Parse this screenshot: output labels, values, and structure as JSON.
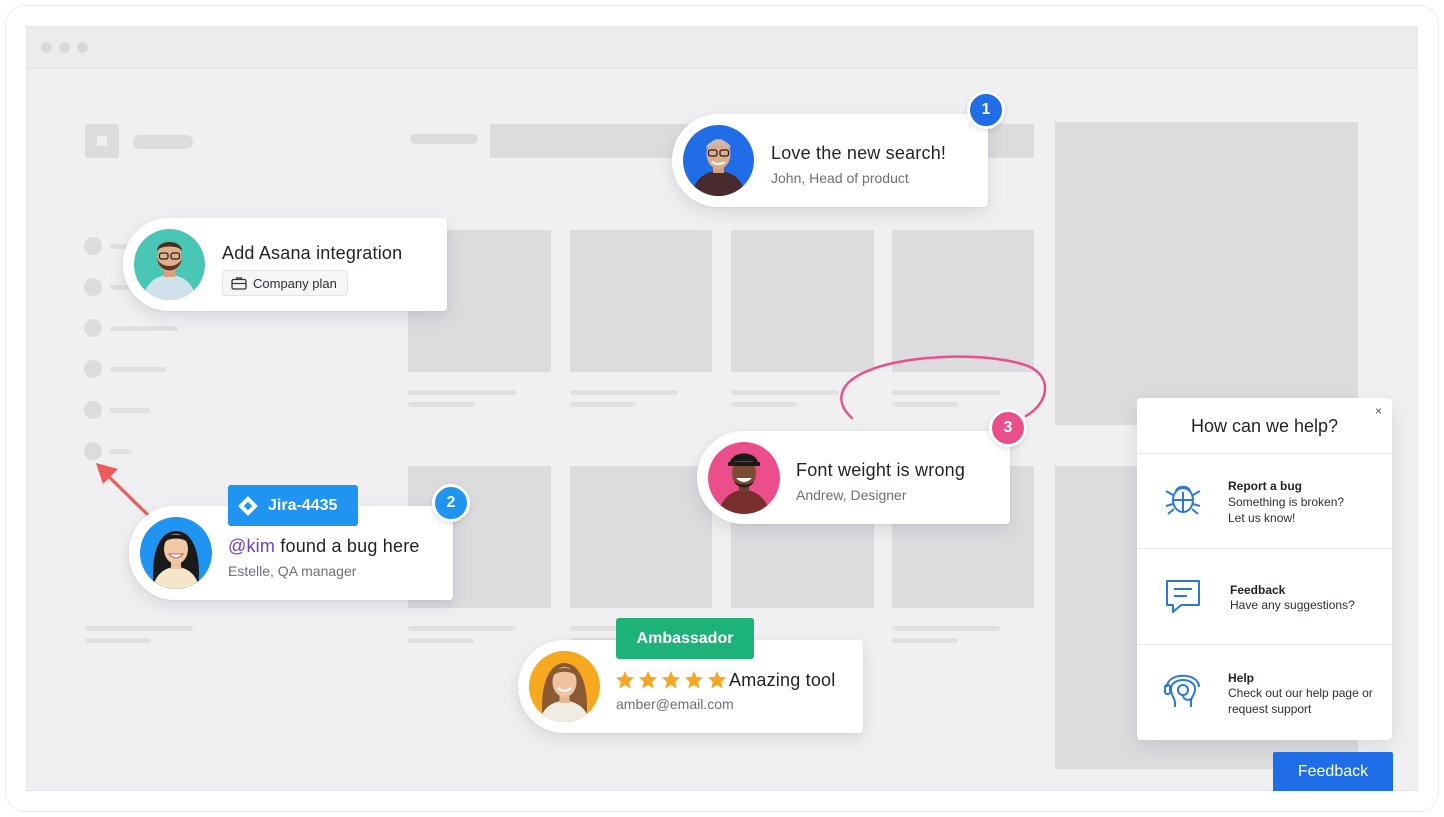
{
  "cards": {
    "love": {
      "title": "Love the new search!",
      "sub": "John, Head of product",
      "badge": "1"
    },
    "asana": {
      "title": "Add Asana integration",
      "chip": "Company plan"
    },
    "bug": {
      "jira": "Jira-4435",
      "mention": "@kim",
      "title_rest": " found a bug here",
      "sub": "Estelle, QA manager",
      "badge": "2"
    },
    "font": {
      "title": "Font weight is wrong",
      "sub": "Andrew, Designer",
      "badge": "3"
    },
    "amb": {
      "tag": "Ambassador",
      "title": "Amazing tool",
      "sub": "amber@email.com",
      "rating": 5
    }
  },
  "help": {
    "title": "How can we help?",
    "close": "×",
    "items": [
      {
        "title": "Report a bug",
        "desc": "Something is broken? Let us know!",
        "icon": "bug-icon"
      },
      {
        "title": "Feedback",
        "desc": "Have any suggestions?",
        "icon": "speech-bubble-icon"
      },
      {
        "title": "Help",
        "desc": "Check out our help page or request support",
        "icon": "support-headset-icon"
      }
    ]
  },
  "feedback_button": "Feedback",
  "colors": {
    "badge_blue": "#1f6ee8",
    "badge_lightblue": "#1f94f0",
    "badge_pink": "#ea4f8b",
    "jira": "#1f94f0",
    "ambassador": "#1db27a",
    "star": "#f5a623",
    "arrow": "#ef5b5b",
    "mention": "#6c3fd1"
  }
}
